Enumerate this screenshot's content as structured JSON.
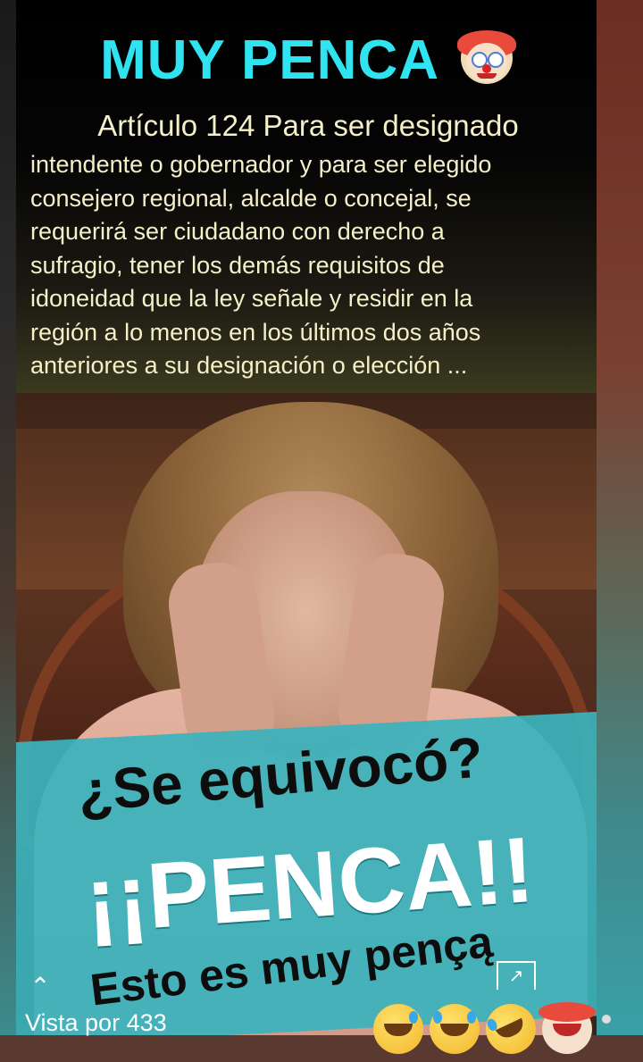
{
  "story": {
    "title": "MUY PENCA",
    "title_emoji": "clown-face",
    "article_heading": "Artículo 124 Para ser designado",
    "article_lines": [
      "intendente o gobernador y para ser elegido",
      "consejero regional, alcalde o concejal, se",
      "requerirá ser ciudadano con derecho a",
      "sufragio, tener los demás requisitos de",
      "idoneidad que la ley señale y residir en la",
      "región a lo menos en los últimos dos años",
      "anteriores a su designación o elección ..."
    ],
    "question": "¿Se equivocó?",
    "shout": "¡¡PENCA!!",
    "footer_line": "Esto es muy pençą",
    "colors": {
      "title": "#2fe3f0",
      "article_text": "#f4f0c8",
      "banner": "#3bb3bc"
    }
  },
  "overlay": {
    "views_label": "Vista por 433",
    "expand_icon": "expand-icon",
    "reactions": [
      "sweat-smile-emoji",
      "joy-emoji",
      "rofl-emoji",
      "clown-emoji"
    ]
  }
}
